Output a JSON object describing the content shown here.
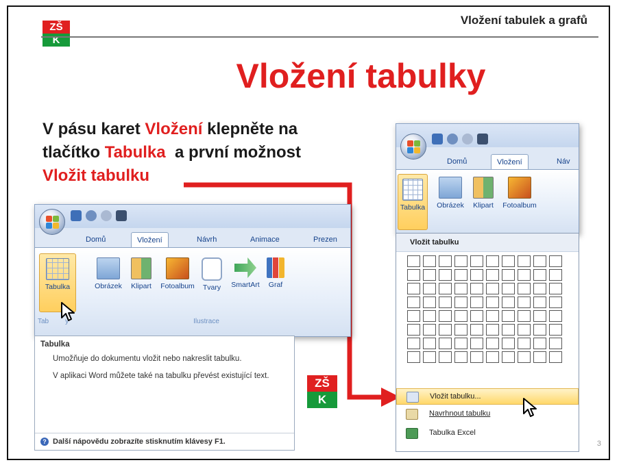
{
  "slide": {
    "header_title": "Vložení tabulek a grafů",
    "title": "Vložení tabulky",
    "page_number": "3",
    "logo": {
      "top": "ZŠ",
      "bottom": "K"
    }
  },
  "instruction": {
    "line1_a": "V pásu karet ",
    "line1_b": "Vložení",
    "line1_c": " klepněte na",
    "line2_a": "tlačítko ",
    "line2_b": "Tabulka",
    "line2_c": "  a první možnost",
    "line3": "Vložit tabulku"
  },
  "left_window": {
    "tabs": [
      "Domů",
      "Vložení",
      "Návrh",
      "Animace",
      "Prezen"
    ],
    "buttons": [
      "Tabulka",
      "Obrázek",
      "Klipart",
      "Fotoalbum",
      "Tvary",
      "SmartArt",
      "Graf"
    ],
    "group_tables": "Tab",
    "group_tables_end": "y",
    "group_illustrations": "Ilustrace",
    "tooltip": {
      "title": "Tabulka",
      "desc1": "Umožňuje do dokumentu vložit nebo nakreslit tabulku.",
      "desc2": "V aplikaci Word můžete také na tabulku převést existující text.",
      "help": "Další nápovědu zobrazíte stisknutím klávesy F1."
    }
  },
  "right_window": {
    "tabs": [
      "Domů",
      "Vložení",
      "Náv"
    ],
    "buttons": [
      "Tabulka",
      "Obrázek",
      "Klipart",
      "Fotoalbum"
    ],
    "dropdown": {
      "header": "Vložit tabulku",
      "grid_cols": 10,
      "grid_rows": 8,
      "items": [
        "Vložit tabulku...",
        "Navrhnout tabulku",
        "Tabulka Excel"
      ]
    }
  },
  "colors": {
    "accent_red": "#e01f1f",
    "logo_green": "#169a3a",
    "office_blue": "#15428b",
    "highlight": "#ffd86a"
  }
}
